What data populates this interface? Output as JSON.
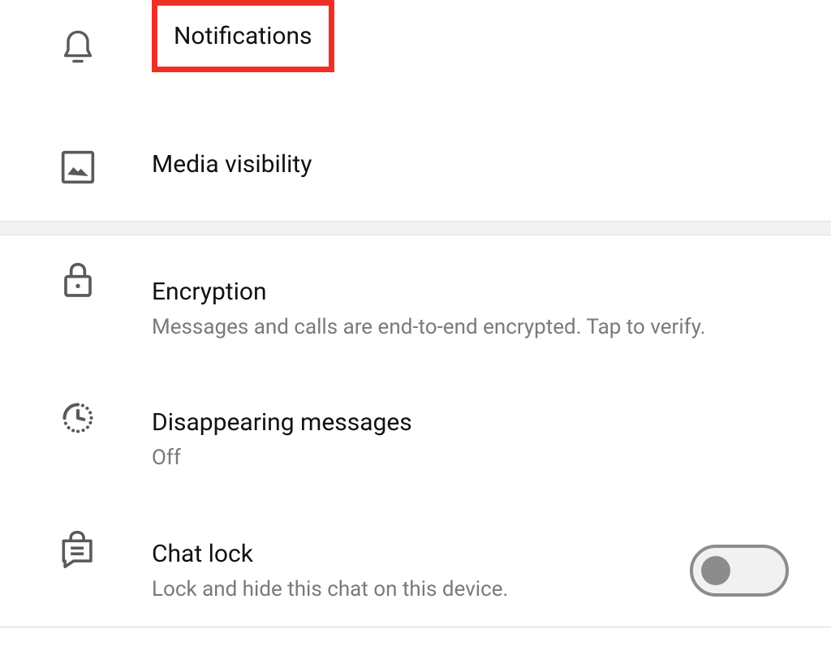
{
  "section1": {
    "notifications": {
      "label": "Notifications"
    },
    "media_visibility": {
      "label": "Media visibility"
    }
  },
  "section2": {
    "encryption": {
      "label": "Encryption",
      "subtitle": "Messages and calls are end-to-end encrypted. Tap to verify."
    },
    "disappearing": {
      "label": "Disappearing messages",
      "subtitle": "Off"
    },
    "chatlock": {
      "label": "Chat lock",
      "subtitle": "Lock and hide this chat on this device.",
      "enabled": false
    }
  }
}
